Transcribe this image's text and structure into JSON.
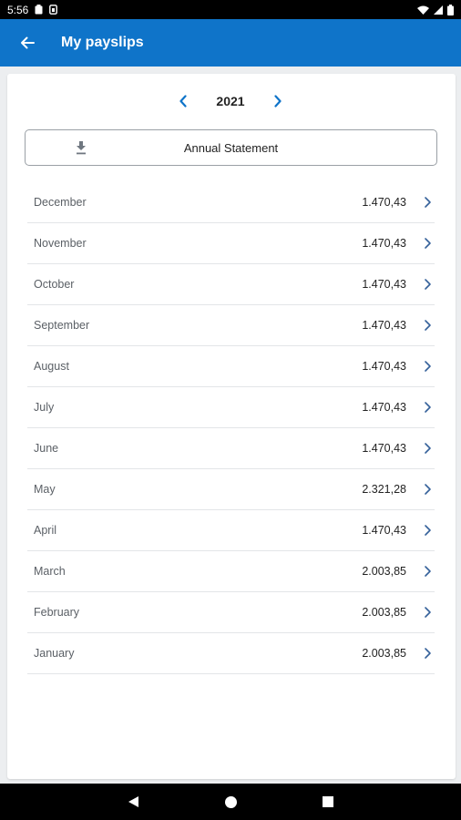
{
  "status_bar": {
    "time": "5:56"
  },
  "app_bar": {
    "title": "My payslips"
  },
  "year_nav": {
    "year": "2021"
  },
  "annual_statement": {
    "label": "Annual Statement"
  },
  "payslips": [
    {
      "month": "December",
      "amount": "1.470,43"
    },
    {
      "month": "November",
      "amount": "1.470,43"
    },
    {
      "month": "October",
      "amount": "1.470,43"
    },
    {
      "month": "September",
      "amount": "1.470,43"
    },
    {
      "month": "August",
      "amount": "1.470,43"
    },
    {
      "month": "July",
      "amount": "1.470,43"
    },
    {
      "month": "June",
      "amount": "1.470,43"
    },
    {
      "month": "May",
      "amount": "2.321,28"
    },
    {
      "month": "April",
      "amount": "1.470,43"
    },
    {
      "month": "March",
      "amount": "2.003,85"
    },
    {
      "month": "February",
      "amount": "2.003,85"
    },
    {
      "month": "January",
      "amount": "2.003,85"
    }
  ],
  "colors": {
    "accent": "#0f74c9",
    "text": "#222222",
    "muted": "#5b6066"
  },
  "icons": {
    "back": "arrow-left-icon",
    "prev_year": "chevron-left-icon",
    "next_year": "chevron-right-icon",
    "download": "download-icon",
    "row": "chevron-right-icon"
  }
}
